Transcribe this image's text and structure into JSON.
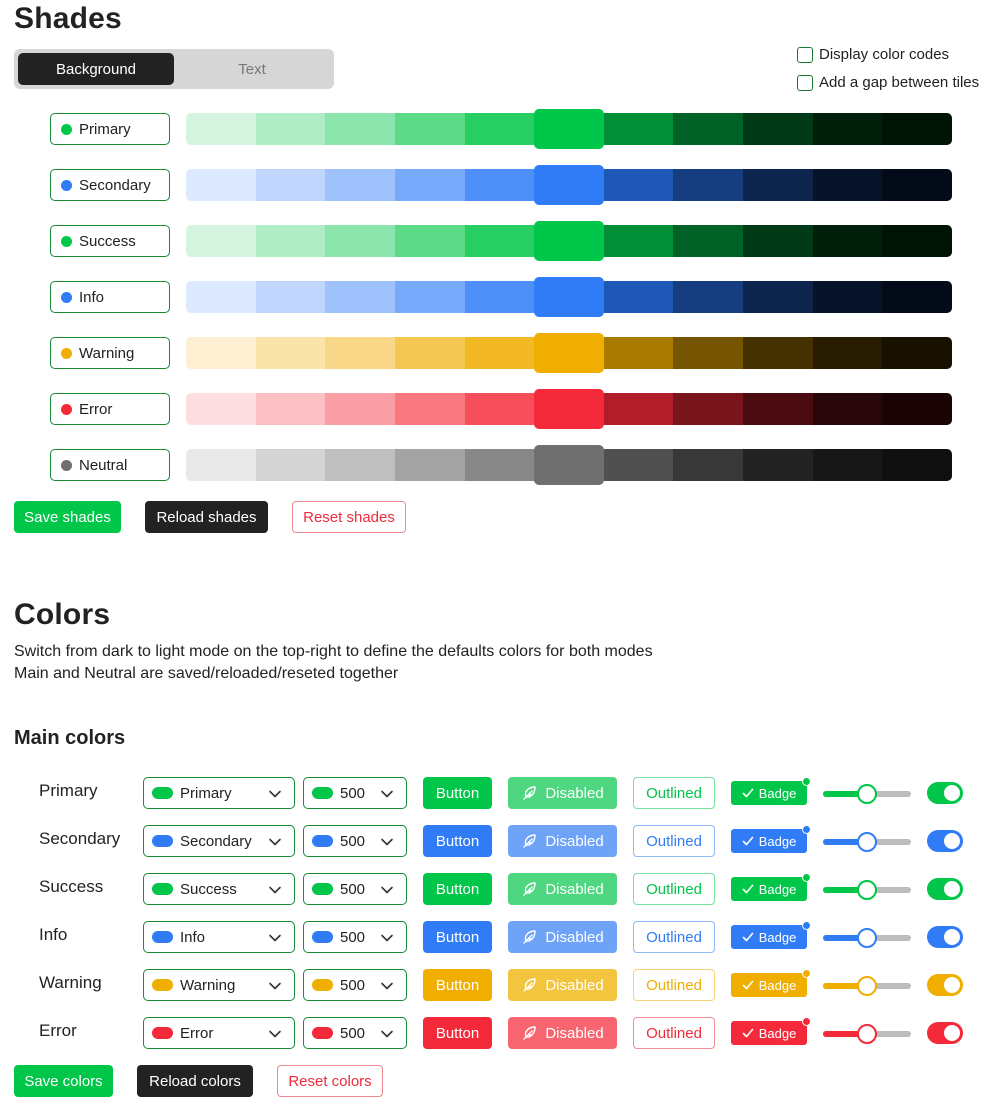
{
  "shades": {
    "title": "Shades",
    "tabs": [
      {
        "label": "Background",
        "active": true
      },
      {
        "label": "Text",
        "active": false
      }
    ],
    "options": [
      {
        "label": "Display color codes",
        "checked": false
      },
      {
        "label": "Add a gap between tiles",
        "checked": false
      }
    ],
    "rows": [
      {
        "name": "Primary",
        "dot": "#00c64a",
        "swatches": [
          "#d6f5e1",
          "#b0edc7",
          "#8be5ac",
          "#5cda87",
          "#27ce62",
          "#00c64a",
          "#008e36",
          "#006226",
          "#003a16",
          "#00200c",
          "#001406"
        ]
      },
      {
        "name": "Secondary",
        "dot": "#2f7cf6",
        "swatches": [
          "#dde9fe",
          "#c0d6fd",
          "#a0c2fc",
          "#78a9fa",
          "#4e8ff8",
          "#2f7cf6",
          "#1f57b7",
          "#163d80",
          "#0d244d",
          "#06132a",
          "#030b18"
        ]
      },
      {
        "name": "Success",
        "dot": "#00c64a",
        "swatches": [
          "#d6f5e1",
          "#b0edc7",
          "#8be5ac",
          "#5cda87",
          "#27ce62",
          "#00c64a",
          "#008e36",
          "#006226",
          "#003a16",
          "#00200c",
          "#001406"
        ]
      },
      {
        "name": "Info",
        "dot": "#2f7cf6",
        "swatches": [
          "#dde9fe",
          "#c0d6fd",
          "#a0c2fc",
          "#78a9fa",
          "#4e8ff8",
          "#2f7cf6",
          "#1f57b7",
          "#163d80",
          "#0d244d",
          "#06132a",
          "#030b18"
        ]
      },
      {
        "name": "Warning",
        "dot": "#f0ae00",
        "swatches": [
          "#fdf0d2",
          "#fbe4aa",
          "#f8d888",
          "#f4c652",
          "#f2b925",
          "#f0ae00",
          "#a87a00",
          "#755500",
          "#453200",
          "#271c00",
          "#181100"
        ]
      },
      {
        "name": "Error",
        "dot": "#f42a3a",
        "swatches": [
          "#fddde0",
          "#fcbfc4",
          "#fa9ea5",
          "#f87880",
          "#f64e5a",
          "#f42a3a",
          "#b11e29",
          "#7a141c",
          "#4a0c11",
          "#290609",
          "#190304"
        ]
      },
      {
        "name": "Neutral",
        "dot": "#6f6f6f",
        "swatches": [
          "#e9e9e9",
          "#d4d4d4",
          "#bfbfbf",
          "#a3a3a3",
          "#888888",
          "#6f6f6f",
          "#505050",
          "#383838",
          "#222222",
          "#171717",
          "#0f0f0f"
        ]
      }
    ],
    "buttons": {
      "save": "Save shades",
      "reload": "Reload shades",
      "reset": "Reset shades"
    }
  },
  "colors": {
    "title": "Colors",
    "description": [
      "Switch from dark to light mode on the top-right to define the defaults colors for both modes",
      "Main and Neutral are saved/reloaded/reseted together"
    ],
    "subtitle": "Main colors",
    "rows": [
      {
        "name": "Primary",
        "select": "Primary",
        "shade": "500",
        "color": "#00c64a",
        "disabled": "#4fd680",
        "button": "Button",
        "disabled_label": "Disabled",
        "outlined": "Outlined",
        "badge": "Badge",
        "slider": 0.5,
        "toggle": true
      },
      {
        "name": "Secondary",
        "select": "Secondary",
        "shade": "500",
        "color": "#2f7cf6",
        "disabled": "#6ea3f8",
        "button": "Button",
        "disabled_label": "Disabled",
        "outlined": "Outlined",
        "badge": "Badge",
        "slider": 0.5,
        "toggle": true
      },
      {
        "name": "Success",
        "select": "Success",
        "shade": "500",
        "color": "#00c64a",
        "disabled": "#4fd680",
        "button": "Button",
        "disabled_label": "Disabled",
        "outlined": "Outlined",
        "badge": "Badge",
        "slider": 0.5,
        "toggle": true
      },
      {
        "name": "Info",
        "select": "Info",
        "shade": "500",
        "color": "#2f7cf6",
        "disabled": "#6ea3f8",
        "button": "Button",
        "disabled_label": "Disabled",
        "outlined": "Outlined",
        "badge": "Badge",
        "slider": 0.5,
        "toggle": true
      },
      {
        "name": "Warning",
        "select": "Warning",
        "shade": "500",
        "color": "#f0ae00",
        "disabled": "#f3c43d",
        "button": "Button",
        "disabled_label": "Disabled",
        "outlined": "Outlined",
        "badge": "Badge",
        "slider": 0.5,
        "toggle": true
      },
      {
        "name": "Error",
        "select": "Error",
        "shade": "500",
        "color": "#f42a3a",
        "disabled": "#f76670",
        "button": "Button",
        "disabled_label": "Disabled",
        "outlined": "Outlined",
        "badge": "Badge",
        "slider": 0.5,
        "toggle": true
      }
    ],
    "buttons": {
      "save": "Save colors",
      "reload": "Reload colors",
      "reset": "Reset colors"
    }
  },
  "icons": {
    "chevron": "chevron-down-icon",
    "check": "check-icon",
    "disabled": "feather-icon"
  }
}
